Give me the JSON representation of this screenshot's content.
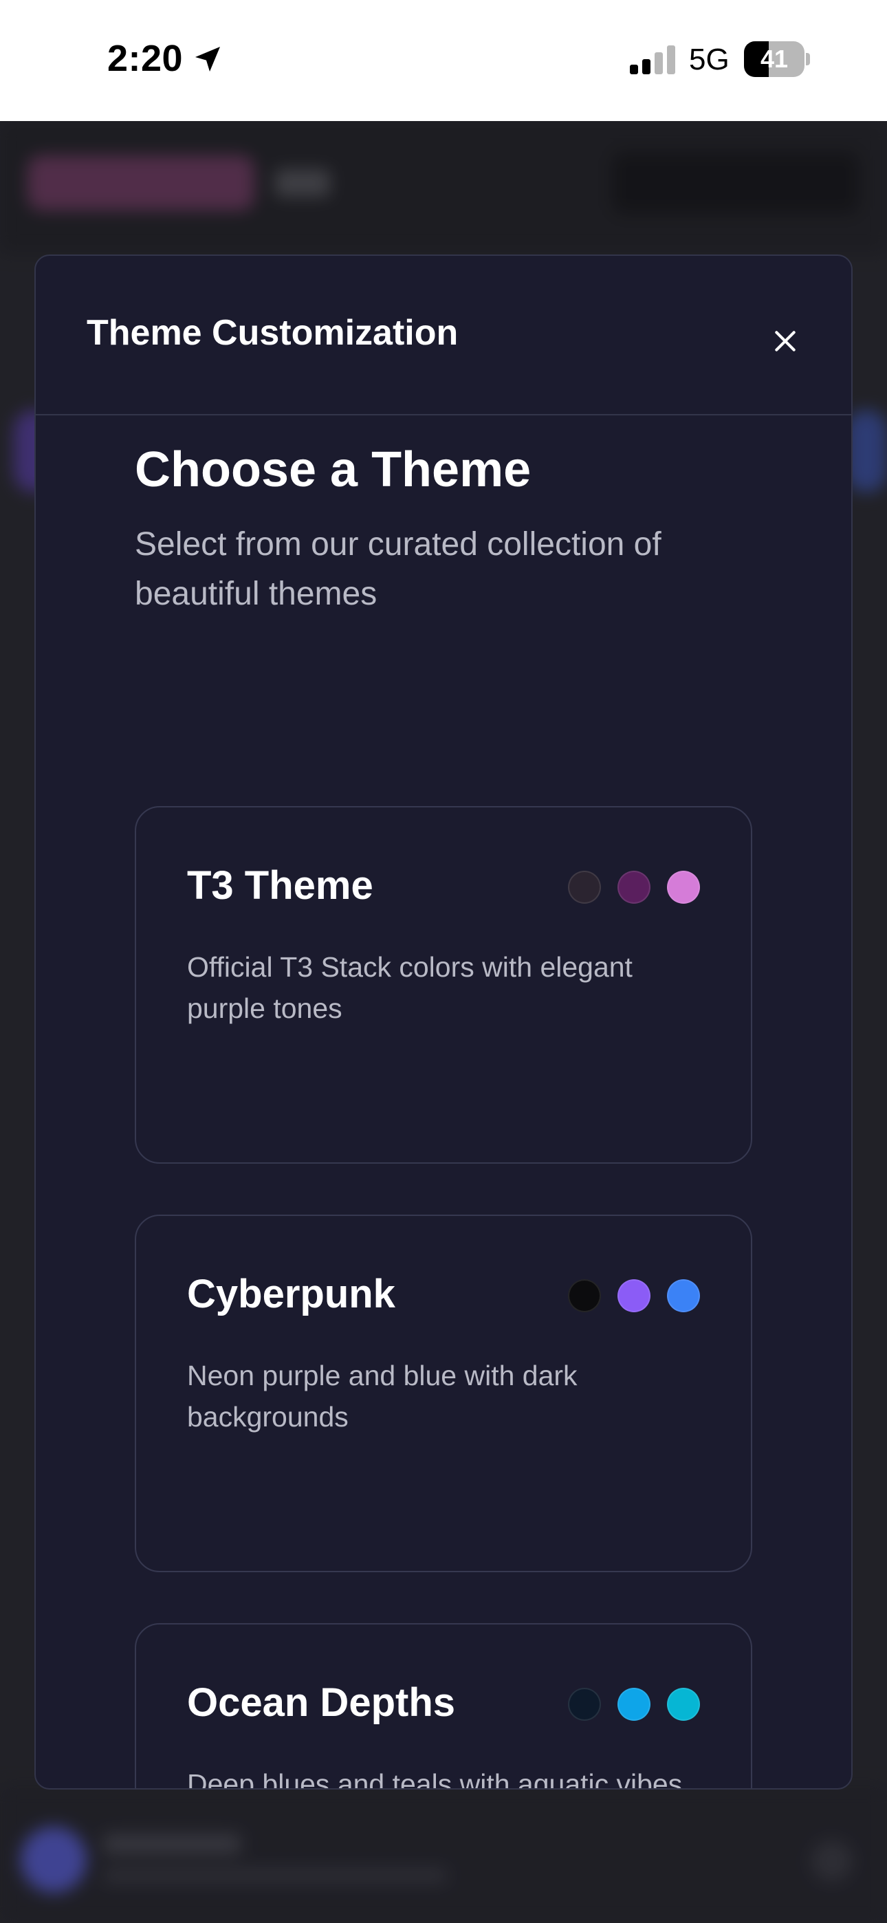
{
  "status_bar": {
    "time": "2:20",
    "network": "5G",
    "battery_level": "41",
    "battery_fraction": 0.41
  },
  "modal": {
    "title": "Theme Customization",
    "close_icon": "close-icon"
  },
  "section": {
    "title": "Choose a Theme",
    "subtitle": "Select from our curated collection of beautiful themes"
  },
  "themes": [
    {
      "name": "T3 Theme",
      "description": "Official T3 Stack colors with elegant purple tones",
      "colors": [
        "#2b2430",
        "#5a1f5e",
        "#d57cd8"
      ]
    },
    {
      "name": "Cyberpunk",
      "description": "Neon purple and blue with dark backgrounds",
      "colors": [
        "#0c0c0e",
        "#8b5cf6",
        "#3b82f6"
      ]
    },
    {
      "name": "Ocean Depths",
      "description": "Deep blues and teals with aquatic vibes",
      "colors": [
        "#0d1a2b",
        "#0ea5e9",
        "#06b6d4"
      ]
    }
  ]
}
